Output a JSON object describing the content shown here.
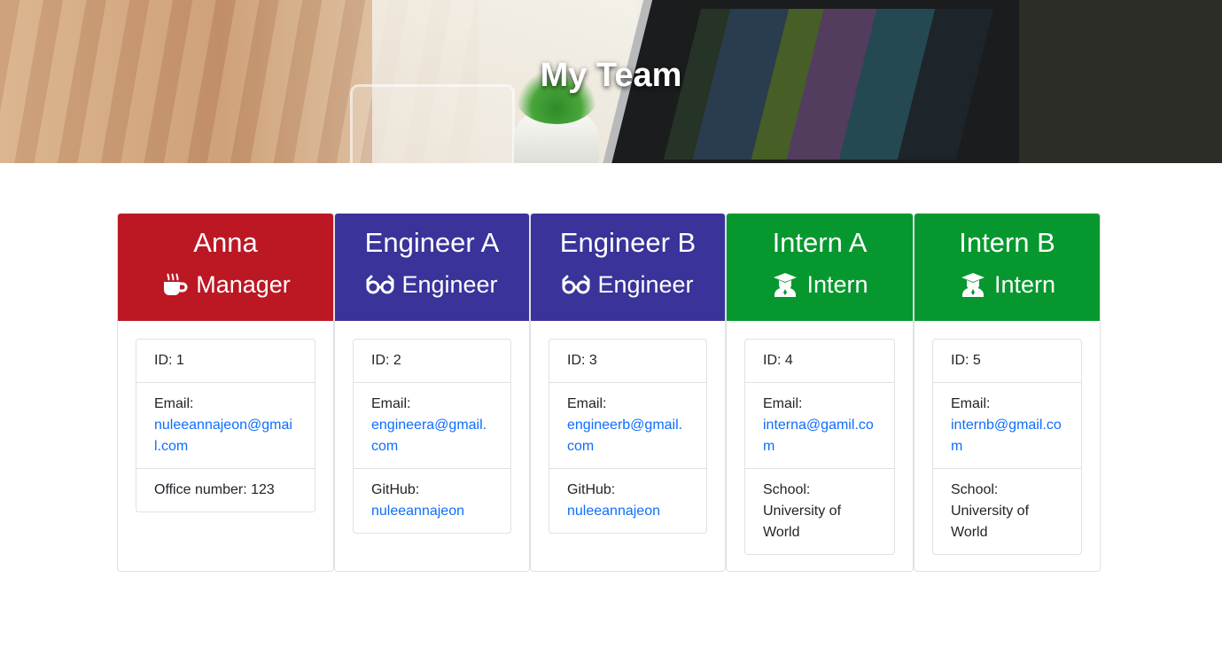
{
  "header": {
    "title": "My Team"
  },
  "employees": [
    {
      "name": "Anna",
      "role": "Manager",
      "icon": "coffee-icon",
      "color": "#bb1824",
      "id_label": "ID: 1",
      "email_label": "Email:",
      "email": "nuleeannajeon@gmail.com",
      "extra_label": "Office number: 123",
      "extra_value": ""
    },
    {
      "name": "Engineer A",
      "role": "Engineer",
      "icon": "glasses-icon",
      "color": "#3a3399",
      "id_label": "ID: 2",
      "email_label": "Email:",
      "email": "engineera@gmail.com",
      "extra_label": "GitHub:",
      "extra_value": "nuleeannajeon"
    },
    {
      "name": "Engineer B",
      "role": "Engineer",
      "icon": "glasses-icon",
      "color": "#3a3399",
      "id_label": "ID: 3",
      "email_label": "Email:",
      "email": "engineerb@gmail.com",
      "extra_label": "GitHub:",
      "extra_value": "nuleeannajeon"
    },
    {
      "name": "Intern A",
      "role": "Intern",
      "icon": "graduate-icon",
      "color": "#06982e",
      "id_label": "ID: 4",
      "email_label": "Email:",
      "email": "interna@gamil.com",
      "extra_label": "School:",
      "extra_value": "University of World"
    },
    {
      "name": "Intern B",
      "role": "Intern",
      "icon": "graduate-icon",
      "color": "#06982e",
      "id_label": "ID: 5",
      "email_label": "Email:",
      "email": "internb@gmail.com",
      "extra_label": "School:",
      "extra_value": "University of World"
    }
  ]
}
